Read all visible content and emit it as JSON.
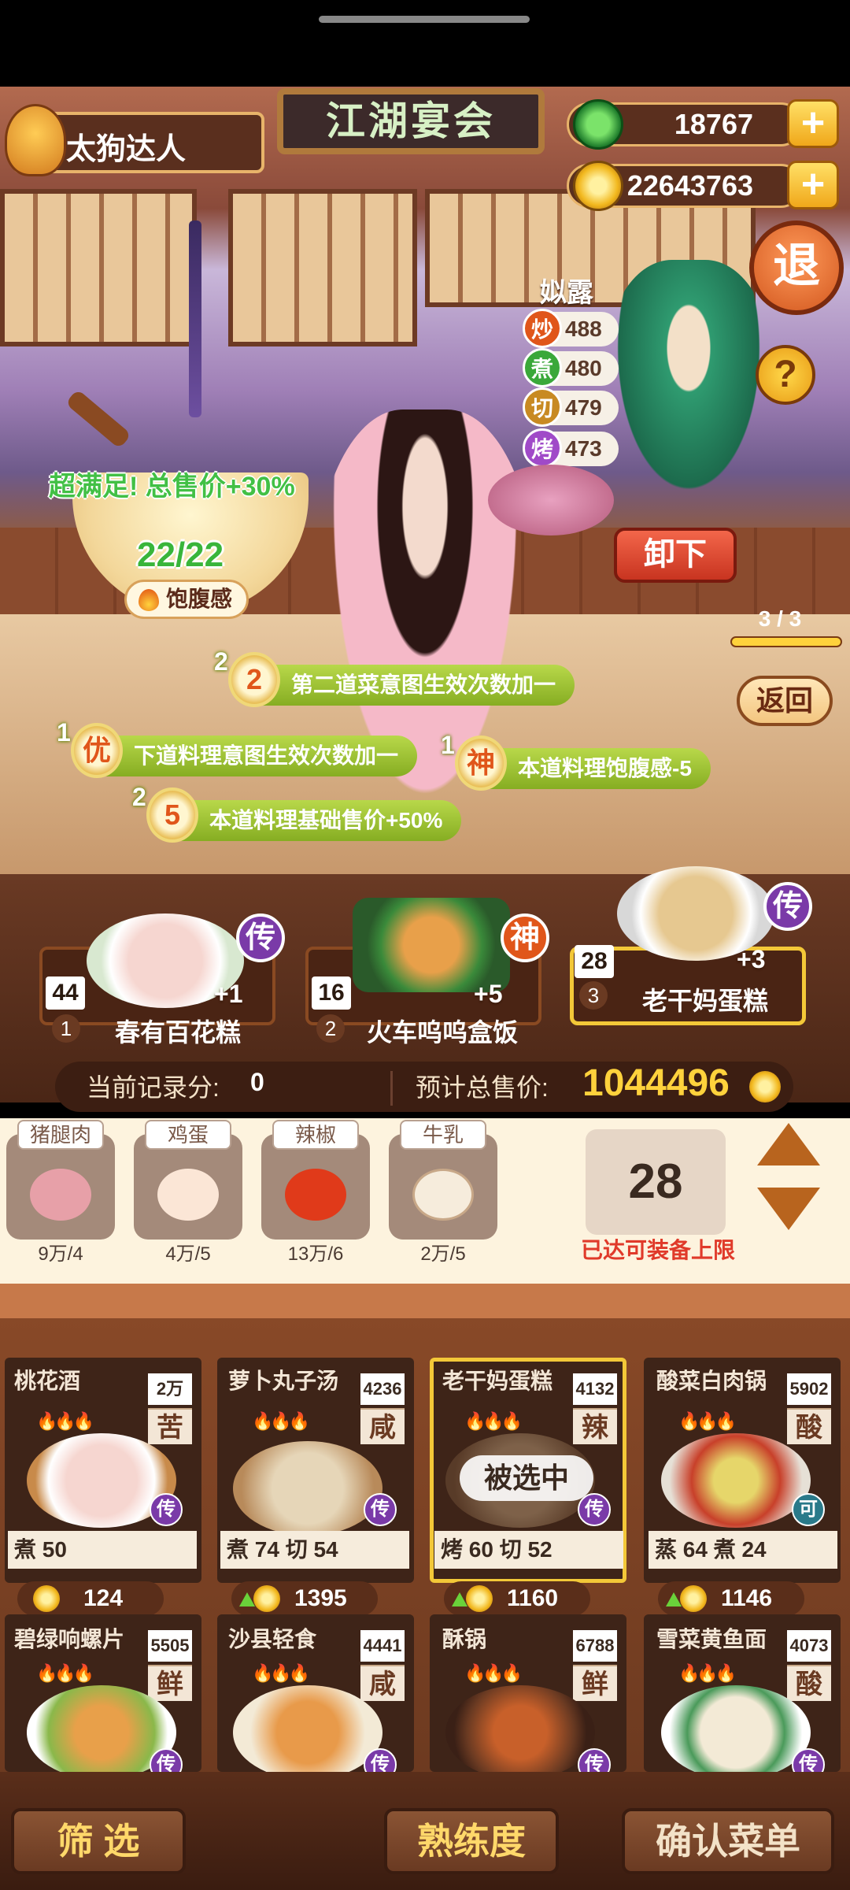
{
  "player": {
    "name": "太狗达人"
  },
  "title_sign": "江湖宴会",
  "currency": {
    "jade": "18767",
    "gold": "22643763",
    "plus_label": "+"
  },
  "exit_label": "退",
  "hint_label": "?",
  "chef": {
    "name": "姒露",
    "skills": [
      {
        "icon": "炒",
        "value": "488",
        "color": "#e0561a"
      },
      {
        "icon": "煮",
        "value": "480",
        "color": "#3aa83a"
      },
      {
        "icon": "切",
        "value": "479",
        "color": "#c88a22"
      },
      {
        "icon": "烤",
        "value": "473",
        "color": "#a04ac8"
      }
    ]
  },
  "satiety": {
    "bonus_text": "超满足!  总售价+30%",
    "value": "22/22",
    "label": "饱腹感"
  },
  "unload_label": "卸下",
  "page_indicator": "3 / 3",
  "back_label": "返回",
  "effects": [
    {
      "count": "2",
      "badge": "2",
      "text": "第二道菜意图生效次数加一"
    },
    {
      "count": "1",
      "badge": "优",
      "text": "下道料理意图生效次数加一"
    },
    {
      "count": "1",
      "badge": "神",
      "text": "本道料理饱腹感-5"
    },
    {
      "count": "2",
      "badge": "5",
      "text": "本道料理基础售价+50%"
    }
  ],
  "stage_dishes": [
    {
      "num": "44",
      "idx": "1",
      "name": "春有百花糕",
      "bonus": "+1",
      "grade": "传",
      "grade_color": "#7a3aa8"
    },
    {
      "num": "16",
      "idx": "2",
      "name": "火车呜呜盒饭",
      "bonus": "+5",
      "grade": "神",
      "grade_color": "#e0561a"
    },
    {
      "num": "28",
      "idx": "3",
      "name": "老干妈蛋糕",
      "bonus": "+3",
      "grade": "传",
      "grade_color": "#7a3aa8"
    }
  ],
  "score": {
    "record_label": "当前记录分:",
    "record_value": "0",
    "estimate_label": "预计总售价:",
    "estimate_value": "1044496"
  },
  "ingredients": [
    {
      "name": "猪腿肉",
      "qty": "9万/4",
      "color": "#e7a0a8"
    },
    {
      "name": "鸡蛋",
      "qty": "4万/5",
      "color": "#fbe6d6"
    },
    {
      "name": "辣椒",
      "qty": "13万/6",
      "color": "#e03a1a"
    },
    {
      "name": "牛乳",
      "qty": "2万/5",
      "color": "#f6ecdc"
    }
  ],
  "quantity": {
    "value": "28",
    "limit_note": "已达可装备上限"
  },
  "menu": [
    {
      "name": "桃花酒",
      "tag": "2万",
      "flavor": "苦",
      "fires": "🔥🔥🔥",
      "grade": "传",
      "grade_color": "#7a3aa8",
      "skills": "煮 50",
      "price": "124",
      "up": false,
      "dish_color": "#f6d6d0"
    },
    {
      "name": "萝卜丸子汤",
      "tag": "4236",
      "flavor": "咸",
      "fires": "🔥🔥🔥",
      "grade": "传",
      "grade_color": "#7a3aa8",
      "skills": "煮 74  切 54",
      "price": "1395",
      "up": true,
      "dish_color": "#e6d6b8"
    },
    {
      "name": "老干妈蛋糕",
      "tag": "4132",
      "flavor": "辣",
      "fires": "🔥🔥🔥",
      "grade": "传",
      "grade_color": "#7a3aa8",
      "skills": "烤 60  切 52",
      "price": "1160",
      "up": true,
      "dish_color": "#a88a6a"
    },
    {
      "name": "酸菜白肉锅",
      "tag": "5902",
      "flavor": "酸",
      "fires": "🔥🔥🔥",
      "grade": "可",
      "grade_color": "#2a7a8a",
      "skills": "蒸 64  煮 24",
      "price": "1146",
      "up": true,
      "dish_color": "#c8402a"
    },
    {
      "name": "碧绿响螺片",
      "tag": "5505",
      "flavor": "鲜",
      "fires": "🔥🔥🔥",
      "grade": "传",
      "grade_color": "#7a3aa8",
      "dish_color": "#8ab84a"
    },
    {
      "name": "沙县轻食",
      "tag": "4441",
      "flavor": "咸",
      "fires": "🔥🔥🔥",
      "grade": "传",
      "grade_color": "#7a3aa8",
      "dish_color": "#e89a4a"
    },
    {
      "name": "酥锅",
      "tag": "6788",
      "flavor": "鲜",
      "fires": "🔥🔥🔥",
      "grade": "传",
      "grade_color": "#7a3aa8",
      "dish_color": "#6a3a22"
    },
    {
      "name": "雪菜黄鱼面",
      "tag": "4073",
      "flavor": "酸",
      "fires": "🔥🔥🔥",
      "grade": "传",
      "grade_color": "#7a3aa8",
      "dish_color": "#f3ead6"
    }
  ],
  "selected_label": "被选中",
  "bottom": {
    "filter": "筛 选",
    "proficiency": "熟练度",
    "confirm": "确认菜单"
  }
}
